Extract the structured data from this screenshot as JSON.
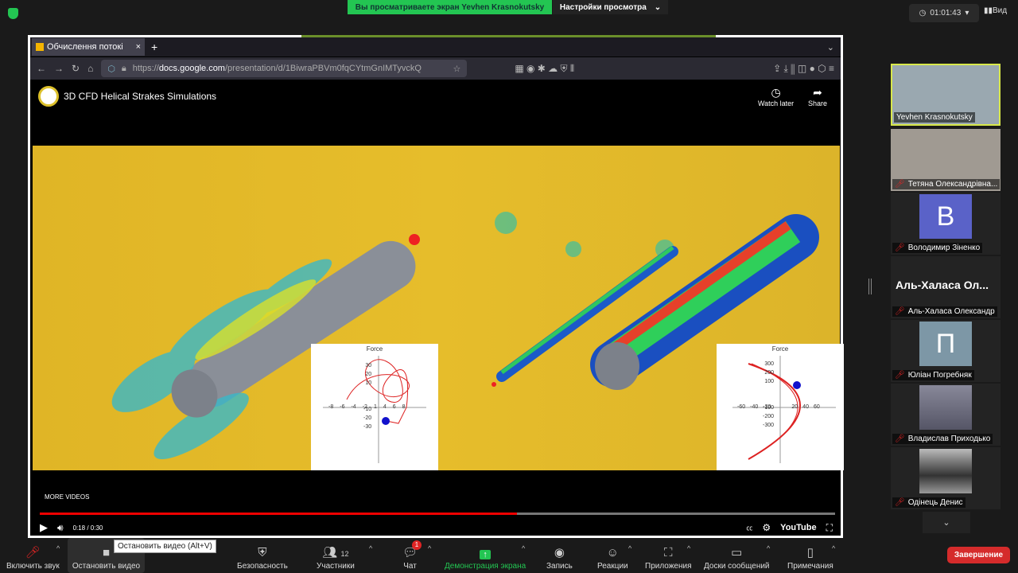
{
  "zoom": {
    "banner": "Вы просматриваете экран Yevhen Krasnokutsky",
    "view_settings": "Настройки просмотра",
    "timer": "01:01:43",
    "view": "Вид"
  },
  "browser": {
    "tab_title": "Обчислення потокі",
    "url_host": "docs.google.com",
    "url_prefix": "https://",
    "url_path": "/presentation/d/1BiwraPBVm0fqCYtmGnIMTyvckQ"
  },
  "youtube": {
    "title": "3D CFD Helical Strakes Simulations",
    "watch_later": "Watch later",
    "share": "Share",
    "more_videos": "MORE VIDEOS",
    "time": "0:18 / 0:30",
    "progress": 0.6,
    "brand": "YouTube"
  },
  "force_plots": [
    {
      "title": "Force",
      "x_ticks": [
        "-8",
        "-6",
        "-4",
        "-2",
        "1",
        "4",
        "6",
        "8"
      ],
      "y_ticks": [
        "30",
        "20",
        "10",
        "-10",
        "-20",
        "-30"
      ]
    },
    {
      "title": "Force",
      "x_ticks": [
        "-60",
        "-40",
        "-20",
        "20",
        "40",
        "60"
      ],
      "y_ticks": [
        "300",
        "200",
        "100",
        "-100",
        "-200",
        "-300"
      ]
    }
  ],
  "participants": [
    {
      "name": "Yevhen Krasnokutsky",
      "muted": false,
      "active": true
    },
    {
      "name": "Тетяна Олександрівна...",
      "muted": true
    },
    {
      "name": "Володимир Зіненко",
      "muted": true,
      "initial": "В",
      "color": "#5a62c8"
    },
    {
      "name": "Аль-Халаса Олександр",
      "muted": true,
      "label": "Аль-Халаса  Ол..."
    },
    {
      "name": "Юліан Погребняк",
      "muted": true,
      "initial": "П",
      "color": "#7d97a6"
    },
    {
      "name": "Владислав Приходько",
      "muted": true
    },
    {
      "name": "Одінець Денис",
      "muted": true
    }
  ],
  "toolbar": {
    "unmute": "Включить звук",
    "stop_video": "Остановить видео",
    "tooltip": "Остановить видео (Alt+V)",
    "security": "Безопасность",
    "participants": "Участники",
    "participants_count": "12",
    "chat": "Чат",
    "chat_badge": "1",
    "share": "Демонстрация экрана",
    "record": "Запись",
    "reactions": "Реакции",
    "apps": "Приложения",
    "whiteboards": "Доски сообщений",
    "notes": "Примечания",
    "end": "Завершение"
  }
}
